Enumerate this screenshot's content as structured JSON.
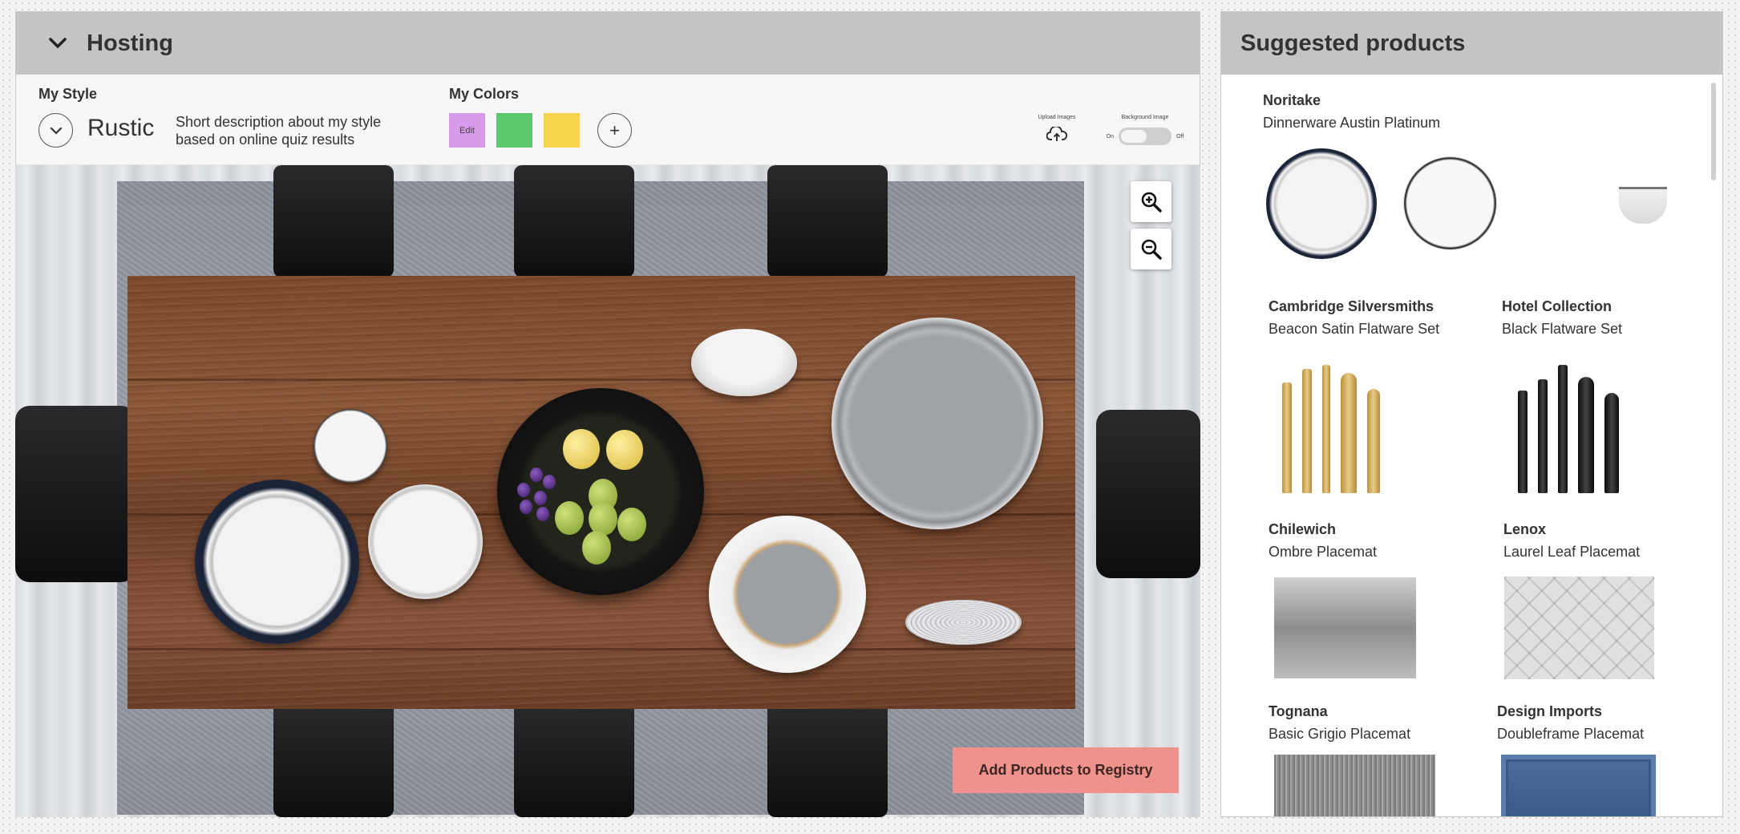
{
  "hosting": {
    "title": "Hosting",
    "my_style_label": "My Style",
    "style_name": "Rustic",
    "style_description": "Short description about my style based on online quiz results",
    "my_colors_label": "My Colors",
    "colors": [
      {
        "label": "Edit",
        "hex": "#d89aea"
      },
      {
        "label": "",
        "hex": "#5ac86e"
      },
      {
        "label": "",
        "hex": "#f5d44b"
      }
    ],
    "add_color_label": "+",
    "upload_label": "Upload Images",
    "background_label": "Background Image",
    "toggle_on": "On",
    "toggle_off": "Off",
    "add_button": "Add Products to Registry"
  },
  "suggested": {
    "title": "Suggested products",
    "products": [
      {
        "brand": "Noritake",
        "name": "Dinnerware Austin Platinum"
      },
      {
        "brand": "Cambridge Silversmiths",
        "name": "Beacon Satin Flatware Set"
      },
      {
        "brand": "Hotel Collection",
        "name": "Black Flatware Set"
      },
      {
        "brand": "Chilewich",
        "name": "Ombre Placemat"
      },
      {
        "brand": "Lenox",
        "name": "Laurel Leaf Placemat"
      },
      {
        "brand": "Tognana",
        "name": "Basic Grigio Placemat"
      },
      {
        "brand": "Design Imports",
        "name": "Doubleframe Placemat"
      }
    ]
  }
}
